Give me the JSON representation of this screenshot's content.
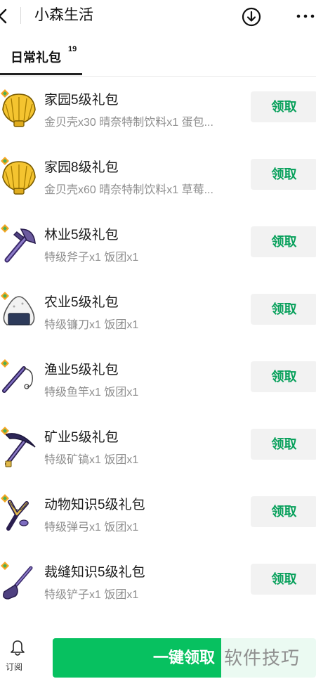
{
  "header": {
    "title": "小森生活",
    "icons": {
      "back": "back-arrow-icon",
      "download": "download-circle-icon",
      "more": "more-dots-icon"
    }
  },
  "tabs": [
    {
      "label": "日常礼包",
      "count": "19",
      "selected": true
    }
  ],
  "items": [
    {
      "title": "家园5级礼包",
      "desc": "金贝壳x30 晴奈特制饮料x1 蛋包...",
      "icon": "golden-shell-icon",
      "button": "领取"
    },
    {
      "title": "家园8级礼包",
      "desc": "金贝壳x60 晴奈特制饮料x1 草莓...",
      "icon": "golden-shell-icon",
      "button": "领取"
    },
    {
      "title": "林业5级礼包",
      "desc": "特级斧子x1 饭团x1",
      "icon": "axe-icon",
      "button": "领取"
    },
    {
      "title": "农业5级礼包",
      "desc": "特级镰刀x1 饭团x1",
      "icon": "rice-ball-icon",
      "button": "领取"
    },
    {
      "title": "渔业5级礼包",
      "desc": "特级鱼竿x1 饭团x1",
      "icon": "fishing-rod-icon",
      "button": "领取"
    },
    {
      "title": "矿业5级礼包",
      "desc": "特级矿镐x1 饭团x1",
      "icon": "pickaxe-icon",
      "button": "领取"
    },
    {
      "title": "动物知识5级礼包",
      "desc": "特级弹弓x1 饭团x1",
      "icon": "slingshot-icon",
      "button": "领取"
    },
    {
      "title": "裁缝知识5级礼包",
      "desc": "特级铲子x1 饭团x1",
      "icon": "shovel-icon",
      "button": "领取"
    }
  ],
  "bottom": {
    "subscribe_label": "订阅",
    "claim_all_label": "一键领取",
    "watermark": "软件技巧"
  },
  "colors": {
    "accent_green": "#07c160",
    "button_text_green": "#07a05b",
    "button_bg": "#f2f2f2"
  }
}
